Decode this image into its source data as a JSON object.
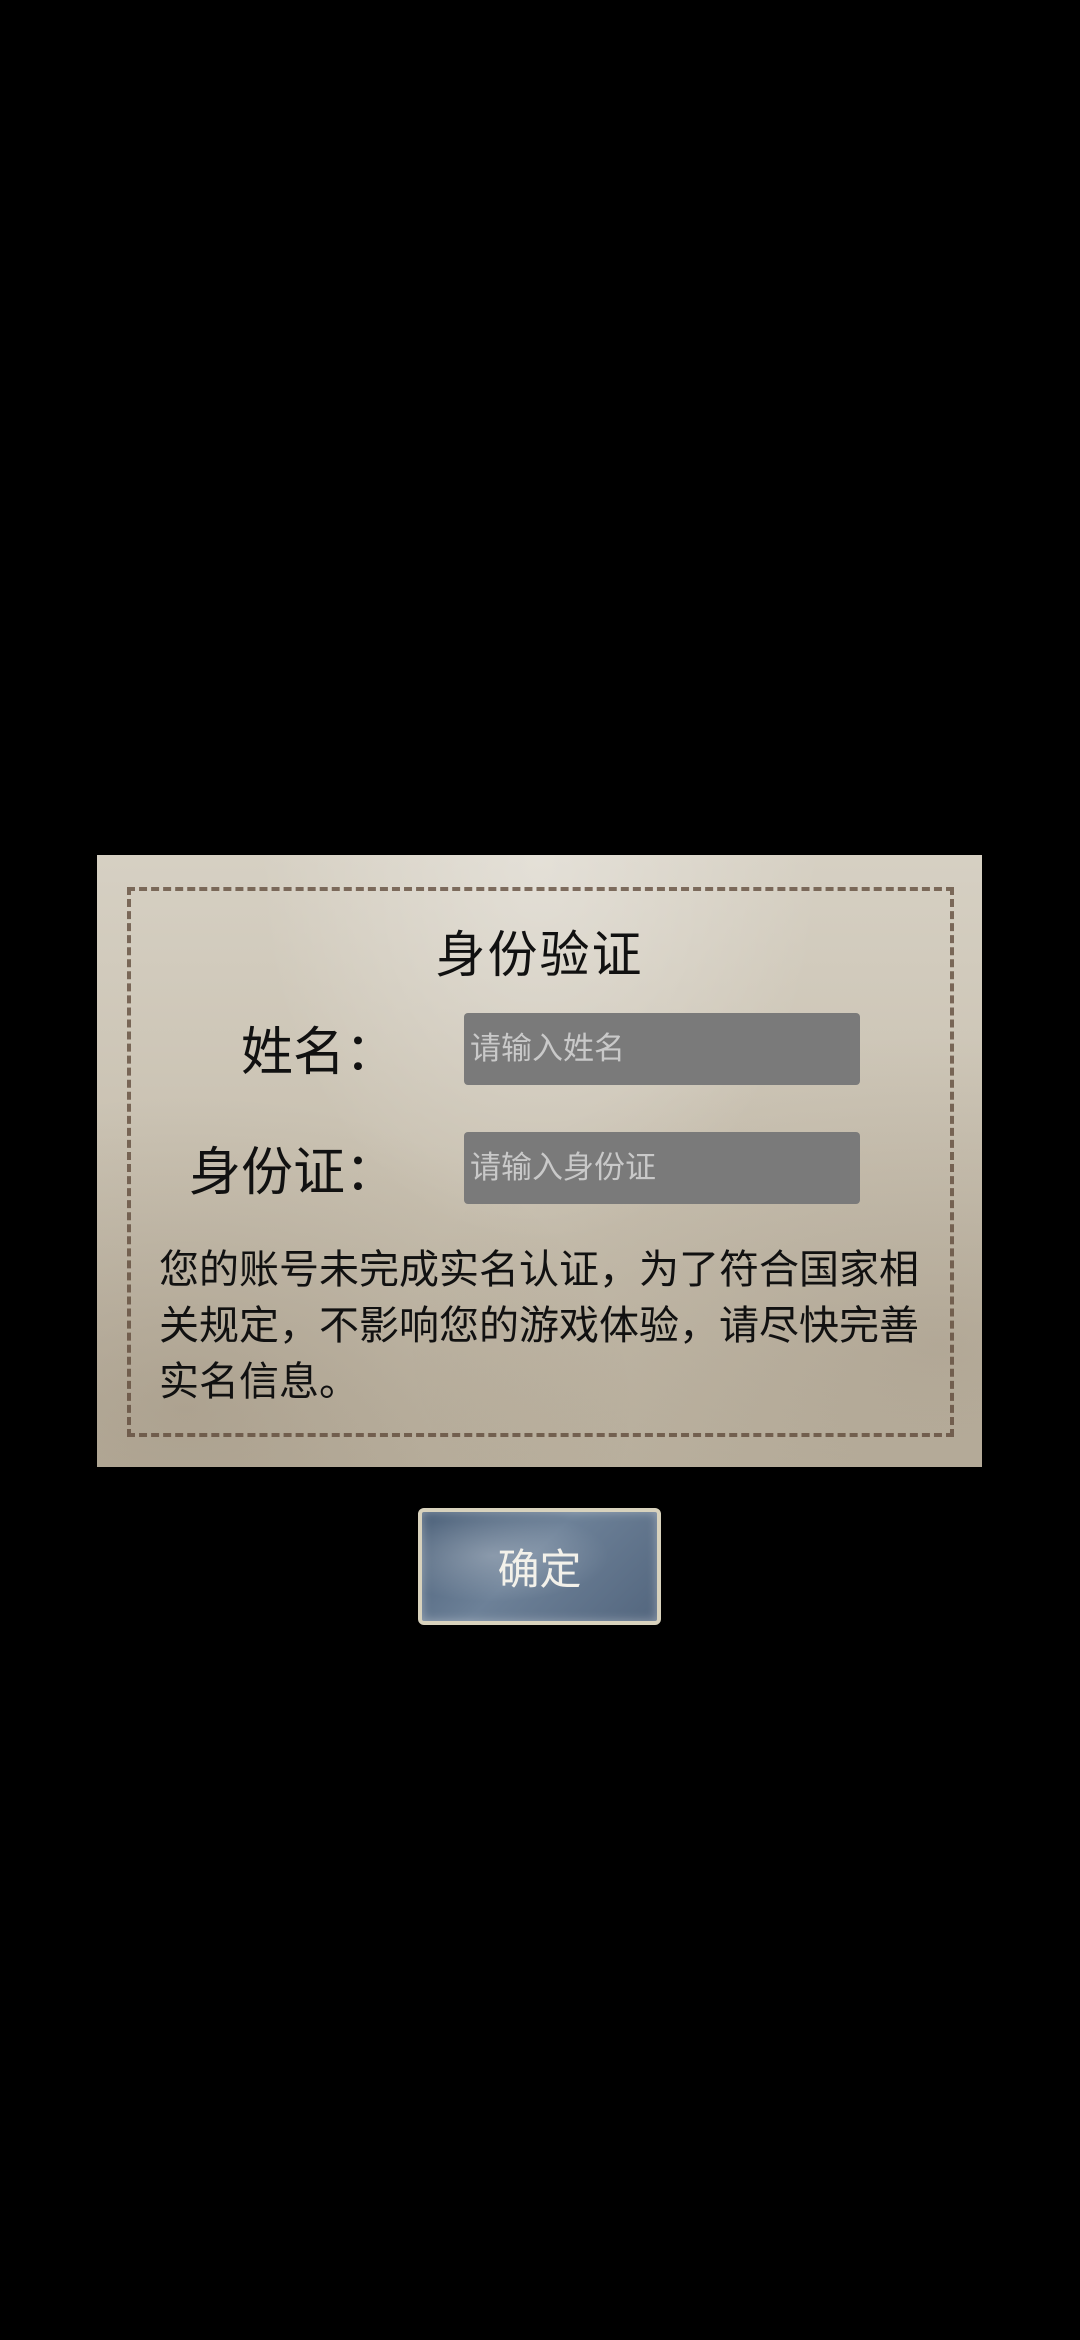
{
  "dialog": {
    "title": "身份验证",
    "name_label": "姓名：",
    "name_placeholder": "请输入姓名",
    "name_value": "",
    "id_label": "身份证：",
    "id_placeholder": "请输入身份证",
    "id_value": "",
    "notice": "您的账号未完成实名认证，为了符合国家相关规定，不影响您的游戏体验，请尽快完善实名信息。"
  },
  "confirm": {
    "label": "确定"
  },
  "colors": {
    "background": "#000000",
    "parchment": "#cbc3b3",
    "input_fill": "#7a7a7a",
    "button_fill": "#5c7089"
  }
}
